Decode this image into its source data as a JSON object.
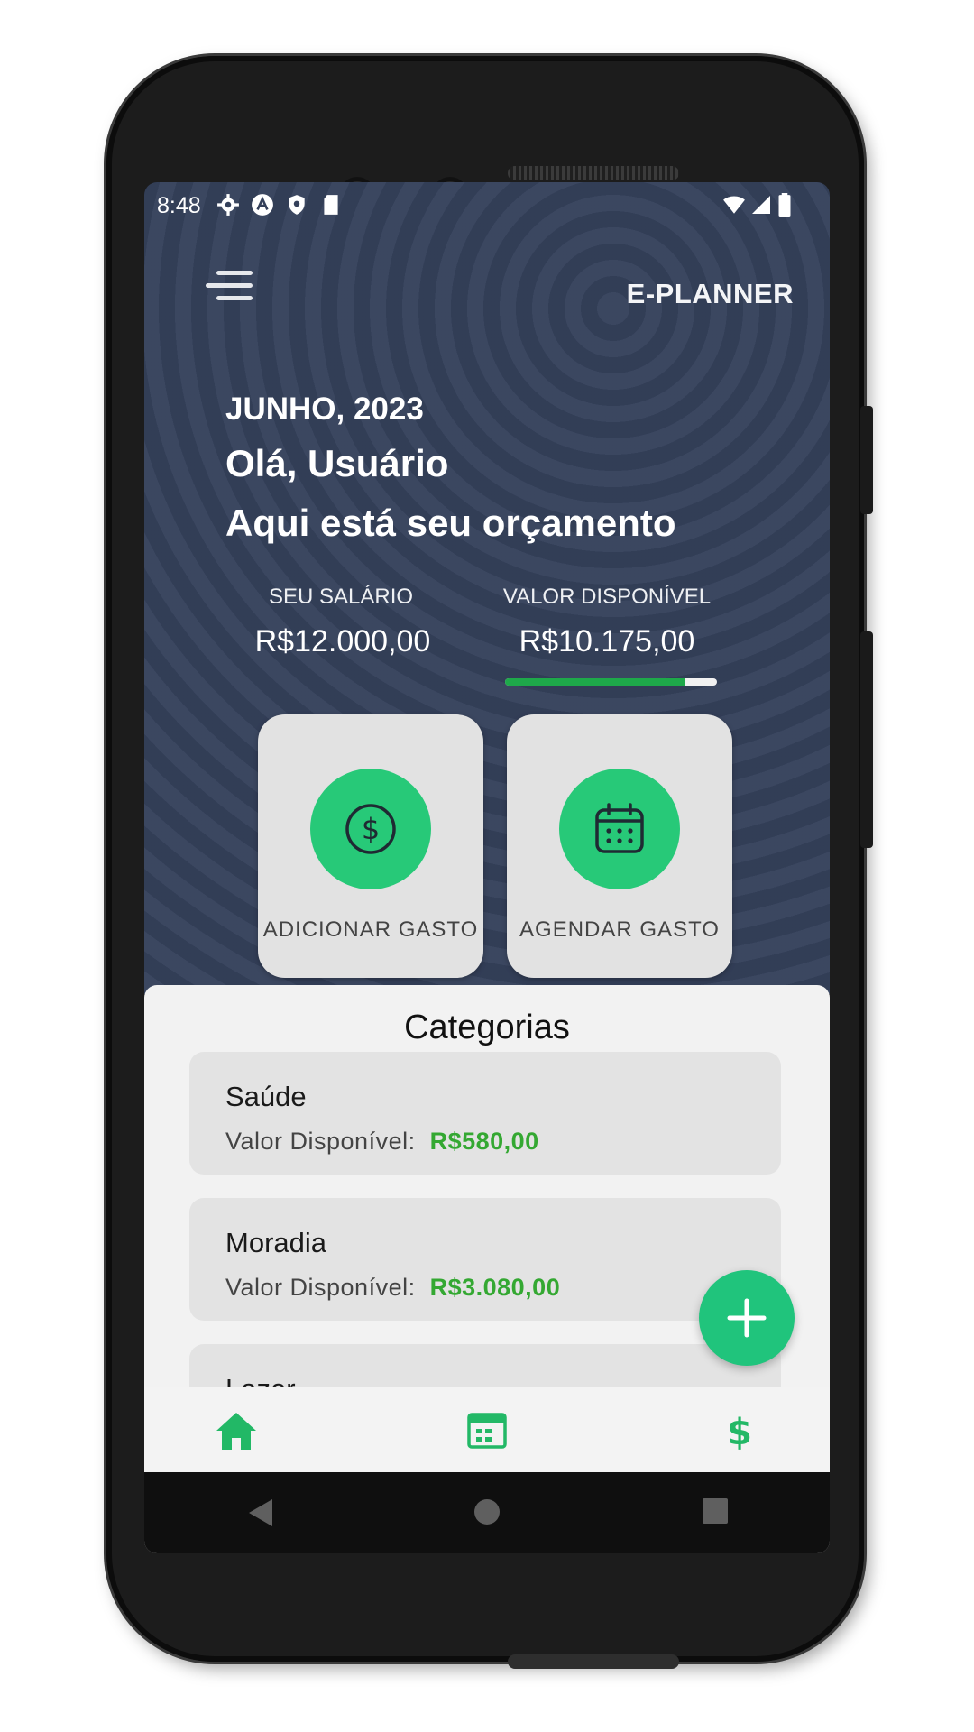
{
  "status": {
    "time": "8:48",
    "icons": [
      "gear-icon",
      "a-icon",
      "shield-icon",
      "sd-card-icon"
    ],
    "right_icons": [
      "wifi-icon",
      "signal-icon",
      "battery-icon"
    ]
  },
  "header": {
    "menu_icon": "hamburger-menu-icon",
    "app_title": "E-PLANNER"
  },
  "hero": {
    "month": "JUNHO, 2023",
    "greeting": "Olá, Usuário",
    "subtitle": "Aqui está seu orçamento"
  },
  "budget": {
    "salary_label": "SEU SALÁRIO",
    "salary_value": "R$12.000,00",
    "available_label": "VALOR DISPONÍVEL",
    "available_value": "R$10.175,00",
    "progress_fraction": 0.85,
    "progress_color": "#1ea84a"
  },
  "actions": [
    {
      "label": "ADICIONAR GASTO",
      "icon": "dollar-circle-icon"
    },
    {
      "label": "AGENDAR GASTO",
      "icon": "calendar-icon"
    }
  ],
  "categories": {
    "title": "Categorias",
    "items": [
      {
        "name": "Saúde",
        "available_label": "Valor Disponível:",
        "available_value": "R$580,00"
      },
      {
        "name": "Moradia",
        "available_label": "Valor Disponível:",
        "available_value": "R$3.080,00"
      },
      {
        "name": "Lazer",
        "available_label": "",
        "available_value": ""
      }
    ]
  },
  "fab": {
    "icon": "plus-icon"
  },
  "bottom_nav": [
    "home-icon",
    "calendar-icon",
    "dollar-icon"
  ],
  "colors": {
    "hero_bg": "#34405a",
    "accent_green": "#27c978",
    "value_green": "#34a832",
    "nav_green": "#22b866"
  }
}
